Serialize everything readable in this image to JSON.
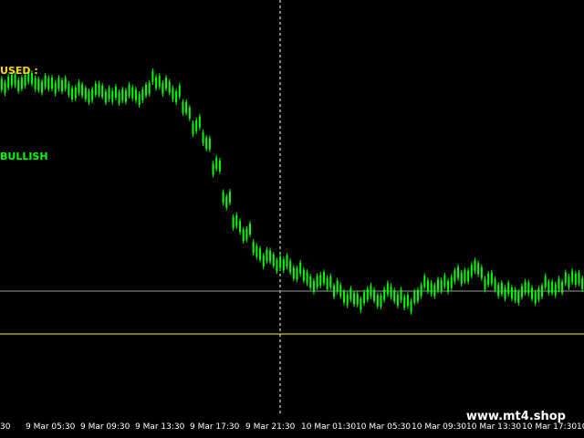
{
  "labels": {
    "paused": "USED :",
    "bias": "BULLISH"
  },
  "watermark": "www.mt4.shop",
  "colors": {
    "background": "#000000",
    "candles": "#00ff00",
    "paused_text": "#ffd700",
    "bias_text": "#00ff00",
    "level_line": "#ffff00",
    "grey_line": "#9a9a9a",
    "cursor_line": "#ffffff"
  },
  "chart_data": {
    "type": "line",
    "x_tick_labels": [
      "30",
      "9 Mar 05:30",
      "9 Mar 09:30",
      "9 Mar 13:30",
      "9 Mar 17:30",
      "9 Mar 21:30",
      "10 Mar 01:30",
      "10 Mar 05:30",
      "10 Mar 09:30",
      "10 Mar 13:30",
      "10 Mar 17:30",
      "10"
    ],
    "series_close_normalized": [
      0.83,
      0.84,
      0.85,
      0.84,
      0.83,
      0.83,
      0.82,
      0.8,
      0.79,
      0.8,
      0.79,
      0.78,
      0.79,
      0.78,
      0.8,
      0.85,
      0.82,
      0.79,
      0.72,
      0.65,
      0.58,
      0.47,
      0.33,
      0.22,
      0.18,
      0.1,
      0.07,
      0.05,
      0.04,
      0.01,
      -0.02,
      -0.04,
      -0.03,
      -0.07,
      -0.1,
      -0.12,
      -0.09,
      -0.11,
      -0.08,
      -0.1,
      -0.13,
      -0.09,
      -0.05,
      -0.06,
      -0.04,
      -0.01,
      0.0,
      0.02,
      -0.03,
      -0.06,
      -0.08,
      -0.09,
      -0.07,
      -0.09,
      -0.05,
      -0.06,
      -0.02,
      -0.03
    ]
  }
}
